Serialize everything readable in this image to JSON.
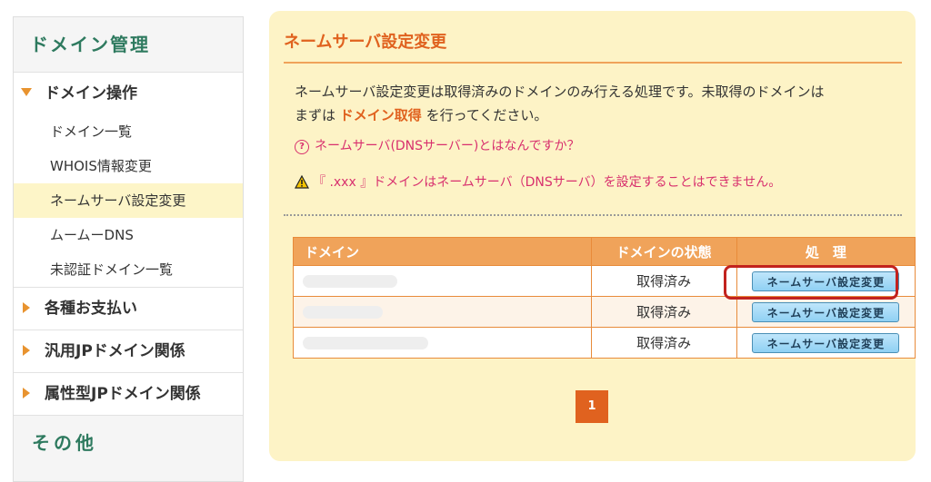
{
  "sidebar": {
    "title": "ドメイン管理",
    "group_main": {
      "label": "ドメイン操作",
      "items": [
        {
          "label": "ドメイン一覧"
        },
        {
          "label": "WHOIS情報変更"
        },
        {
          "label": "ネームサーバ設定変更"
        },
        {
          "label": "ムームーDNS"
        },
        {
          "label": "未認証ドメイン一覧"
        }
      ]
    },
    "groups": [
      {
        "label": "各種お支払い"
      },
      {
        "label": "汎用JPドメイン関係"
      },
      {
        "label": "属性型JPドメイン関係"
      }
    ],
    "other_title": "その他"
  },
  "main": {
    "title": "ネームサーバ設定変更",
    "desc_part1": "ネームサーバ設定変更は取得済みのドメインのみ行える処理です。未取得のドメインは",
    "desc_part2": "まずは ",
    "desc_link": "ドメイン取得",
    "desc_part3": " を行ってください。",
    "help_link": "ネームサーバ(DNSサーバー)とはなんですか？",
    "warning": "『 .xxx 』ドメインはネームサーバ（DNSサーバ）を設定することはできません。",
    "table": {
      "headers": [
        "ドメイン",
        "ドメインの状態",
        "処　理"
      ],
      "rows": [
        {
          "status": "取得済み",
          "action": "ネームサーバ設定変更"
        },
        {
          "status": "取得済み",
          "action": "ネームサーバ設定変更"
        },
        {
          "status": "取得済み",
          "action": "ネームサーバ設定変更"
        }
      ]
    },
    "pagination": {
      "current": "1"
    }
  },
  "colors": {
    "accent": "#e0621f",
    "link": "#d8306e",
    "header_bg": "#f0a35a",
    "panel_bg": "#fdf3c6",
    "sidebar_title": "#2e7a5f",
    "highlight": "#c2231e"
  }
}
